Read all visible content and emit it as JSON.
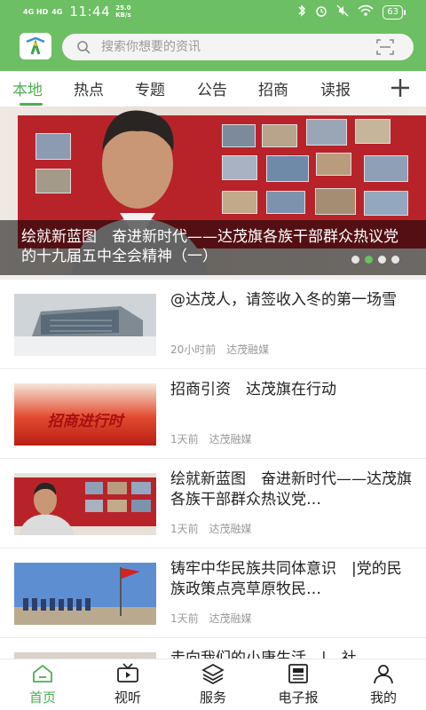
{
  "statusbar": {
    "signal1": "4G HD",
    "signal2": "4G",
    "time": "11:44",
    "speed_value": "25.0",
    "speed_unit": "KB/s",
    "battery": "63"
  },
  "search": {
    "placeholder": "搜索你想要的资讯"
  },
  "tabs": [
    {
      "label": "本地",
      "active": true
    },
    {
      "label": "热点"
    },
    {
      "label": "专题"
    },
    {
      "label": "公告"
    },
    {
      "label": "招商"
    },
    {
      "label": "读报"
    }
  ],
  "banner": {
    "caption": "绘就新蓝图　奋进新时代——达茂旗各族干部群众热议党的十九届五中全会精神（一）",
    "dots": 4,
    "active_dot": 1
  },
  "news": [
    {
      "title": "@达茂人，请签收入冬的第一场雪",
      "time": "20小时前",
      "source": "达茂融媒"
    },
    {
      "title": "招商引资　达茂旗在行动",
      "time": "1天前",
      "source": "达茂融媒",
      "thumb_text": "招商进行时"
    },
    {
      "title": "绘就新蓝图　奋进新时代——达茂旗各族干部群众热议党…",
      "time": "1天前",
      "source": "达茂融媒"
    },
    {
      "title": "铸牢中华民族共同体意识　|党的民族政策点亮草原牧民…",
      "time": "1天前",
      "source": "达茂融媒"
    },
    {
      "title": "走向我们的小康生活　|　社"
    }
  ],
  "bottomnav": [
    {
      "label": "首页",
      "icon": "home-icon",
      "active": true
    },
    {
      "label": "视听",
      "icon": "tv-icon"
    },
    {
      "label": "服务",
      "icon": "layers-icon"
    },
    {
      "label": "电子报",
      "icon": "newspaper-icon"
    },
    {
      "label": "我的",
      "icon": "user-icon"
    }
  ],
  "colors": {
    "brand": "#6cc063",
    "active_text": "#4caf50"
  }
}
